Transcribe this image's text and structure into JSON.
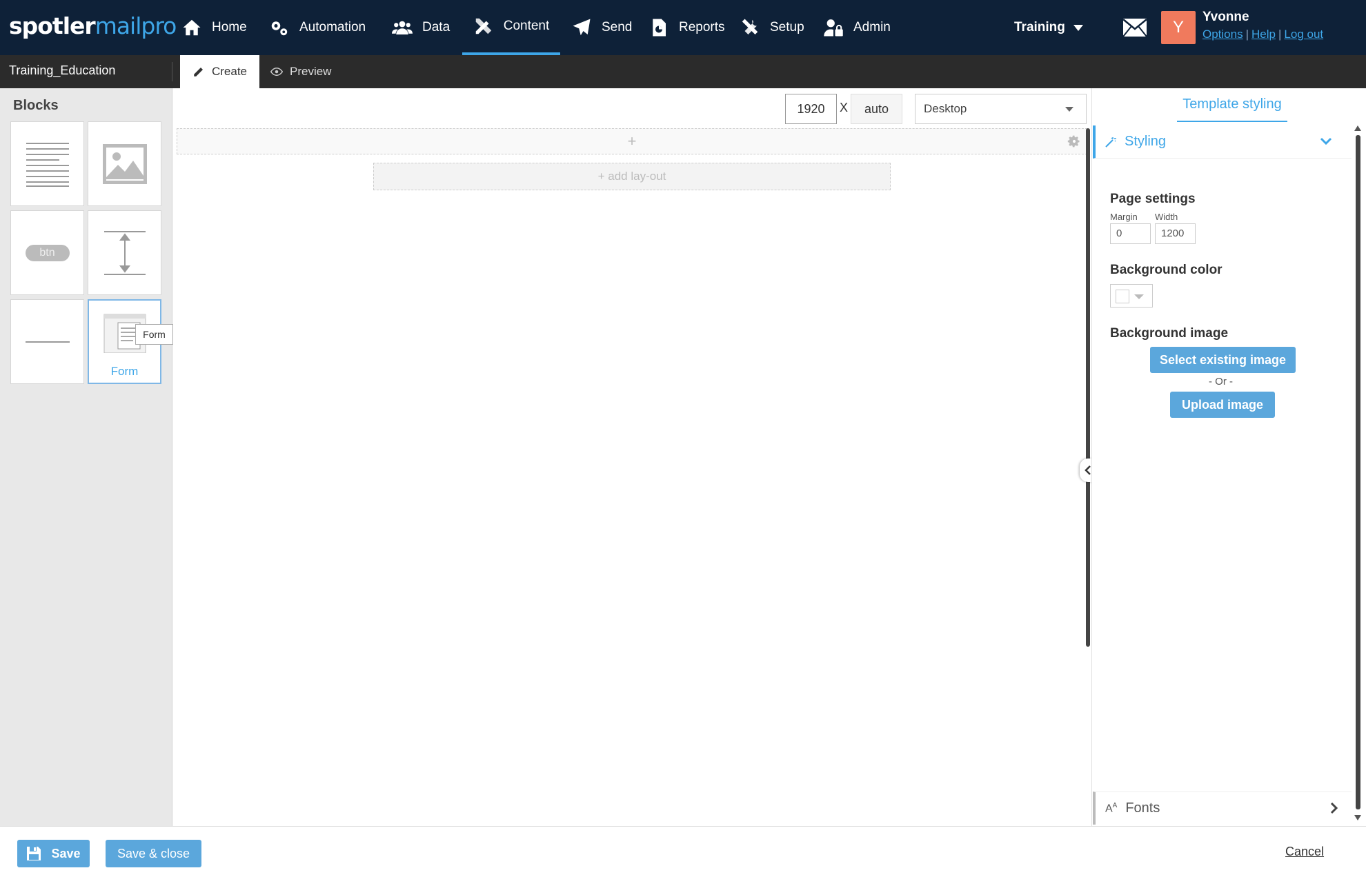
{
  "brand": {
    "logo_main": "spotler",
    "logo_accent": "mailpro"
  },
  "nav": {
    "items": [
      {
        "label": "Home",
        "icon": "home-icon"
      },
      {
        "label": "Automation",
        "icon": "gears-icon"
      },
      {
        "label": "Data",
        "icon": "users-icon"
      },
      {
        "label": "Content",
        "icon": "pencil-ruler-icon",
        "active": true
      },
      {
        "label": "Send",
        "icon": "paper-plane-icon"
      },
      {
        "label": "Reports",
        "icon": "report-icon"
      },
      {
        "label": "Setup",
        "icon": "tools-icon"
      },
      {
        "label": "Admin",
        "icon": "user-lock-icon"
      }
    ],
    "workspace": "Training"
  },
  "user": {
    "initial": "Y",
    "name": "Yvonne",
    "links": [
      "Options",
      "Help",
      "Log out"
    ]
  },
  "subbar": {
    "document_name": "Training_Education",
    "tabs": {
      "create": "Create",
      "preview": "Preview"
    }
  },
  "sidebar": {
    "title": "Blocks",
    "blocks": [
      {
        "name": "text-block",
        "icon": "text-lines-icon"
      },
      {
        "name": "image-block",
        "icon": "image-icon"
      },
      {
        "name": "button-block",
        "icon": "button-icon",
        "label": "btn"
      },
      {
        "name": "spacer-block",
        "icon": "spacer-icon"
      },
      {
        "name": "divider-block",
        "icon": "divider-icon"
      },
      {
        "name": "form-block",
        "icon": "form-icon",
        "label": "Form",
        "selected": true
      }
    ],
    "tooltip": "Form"
  },
  "canvas": {
    "width": "1920",
    "separator": "X",
    "height": "auto",
    "device": "Desktop",
    "row_plus": "+",
    "add_layout": "+ add lay-out"
  },
  "right_panel": {
    "title": "Template styling",
    "styling_section": "Styling",
    "page_settings": {
      "title": "Page settings",
      "margin_label": "Margin",
      "margin_value": "0",
      "width_label": "Width",
      "width_value": "1200"
    },
    "background_color": {
      "title": "Background color",
      "value": "#ffffff"
    },
    "background_image": {
      "title": "Background image",
      "select_button": "Select existing image",
      "or_text": "- Or -",
      "upload_button": "Upload image"
    },
    "fonts_section": "Fonts"
  },
  "footer": {
    "save": "Save",
    "save_close": "Save & close",
    "cancel": "Cancel"
  },
  "colors": {
    "nav_bg": "#0e2138",
    "accent": "#3ea6e8",
    "avatar_bg": "#f07a5d",
    "button_bg": "#5ba7dc"
  }
}
